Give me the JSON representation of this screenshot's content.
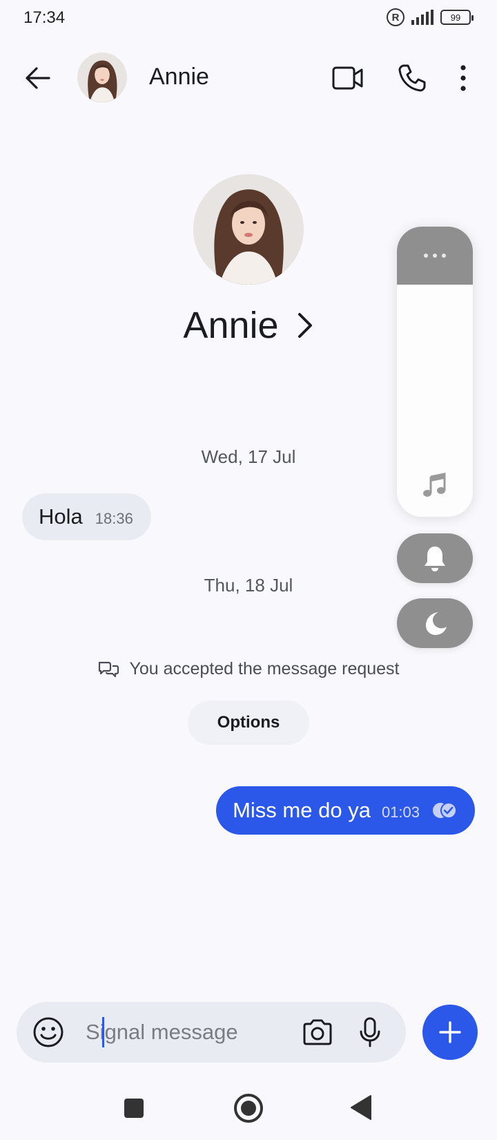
{
  "status_bar": {
    "time": "17:34",
    "registered": "R",
    "battery": "99"
  },
  "header": {
    "contact_name": "Annie"
  },
  "profile": {
    "name": "Annie"
  },
  "conversation": {
    "date1": "Wed, 17 Jul",
    "incoming": {
      "text": "Hola",
      "time": "18:36"
    },
    "date2": "Thu, 18 Jul",
    "system_notice": "You accepted the message request",
    "options_label": "Options",
    "outgoing": {
      "text": "Miss me do ya",
      "time": "01:03"
    }
  },
  "composer": {
    "placeholder": "Signal message"
  },
  "colors": {
    "accent": "#2c58e9",
    "background": "#f9f9fd",
    "bubble_in": "#e9ebf2"
  }
}
